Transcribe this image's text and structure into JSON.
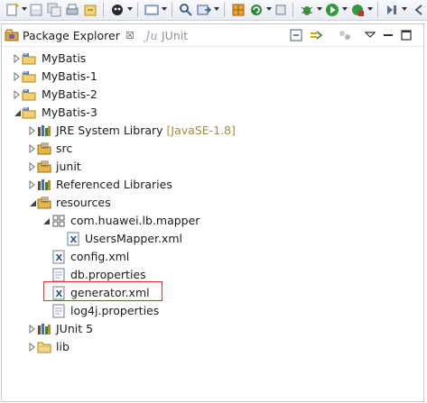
{
  "view": {
    "tabs": [
      {
        "label": "Package Explorer",
        "close": "☒",
        "active": true
      },
      {
        "label": "JUnit",
        "active": false
      }
    ]
  },
  "tree": {
    "items": [
      {
        "label": "MyBatis",
        "expanded": false,
        "icon": "project-folder-icon"
      },
      {
        "label": "MyBatis-1",
        "expanded": false,
        "icon": "project-folder-icon"
      },
      {
        "label": "MyBatis-2",
        "expanded": false,
        "icon": "project-folder-icon"
      },
      {
        "label": "MyBatis-3",
        "expanded": true,
        "icon": "project-folder-icon"
      },
      {
        "label": "JRE System Library",
        "decoration": "[JavaSE-1.8]",
        "expanded": false,
        "icon": "library-icon"
      },
      {
        "label": "src",
        "expanded": false,
        "icon": "source-folder-icon"
      },
      {
        "label": "junit",
        "expanded": false,
        "icon": "source-folder-icon"
      },
      {
        "label": "Referenced Libraries",
        "expanded": false,
        "icon": "library-icon"
      },
      {
        "label": "resources",
        "expanded": true,
        "icon": "source-folder-icon"
      },
      {
        "label": "com.huawei.lb.mapper",
        "expanded": true,
        "icon": "package-icon"
      },
      {
        "label": "UsersMapper.xml",
        "icon": "xml-file-icon"
      },
      {
        "label": "config.xml",
        "icon": "xml-file-icon"
      },
      {
        "label": "db.properties",
        "icon": "text-file-icon"
      },
      {
        "label": "generator.xml",
        "icon": "xml-file-icon",
        "highlighted": true
      },
      {
        "label": "log4j.properties",
        "icon": "text-file-icon"
      },
      {
        "label": "JUnit 5",
        "expanded": false,
        "icon": "library-icon"
      },
      {
        "label": "lib",
        "expanded": false,
        "icon": "folder-icon"
      }
    ]
  },
  "colors": {
    "highlight_border": "#e03030",
    "decoration_text": "#a58b3c"
  }
}
